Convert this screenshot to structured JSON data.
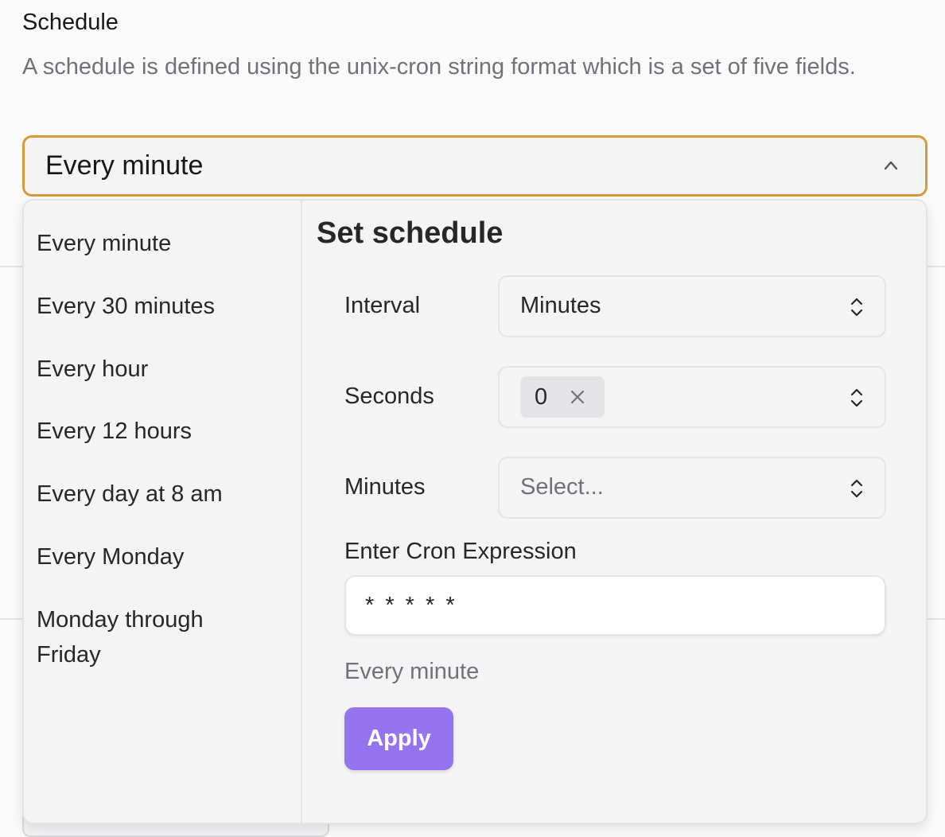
{
  "field": {
    "title": "Schedule",
    "description": "A schedule is defined using the unix-cron string format which is a set of five fields.",
    "selected": "Every minute",
    "accent_color": "#d89a3a"
  },
  "presets": [
    "Every minute",
    "Every 30 minutes",
    "Every hour",
    "Every 12 hours",
    "Every day at 8 am",
    "Every Monday",
    "Monday through Friday"
  ],
  "editor": {
    "title": "Set schedule",
    "interval": {
      "label": "Interval",
      "value": "Minutes"
    },
    "seconds": {
      "label": "Seconds",
      "chips": [
        "0"
      ]
    },
    "minutes": {
      "label": "Minutes",
      "placeholder": "Select..."
    },
    "cron": {
      "label": "Enter Cron Expression",
      "value": "* * * * *",
      "description": "Every minute"
    },
    "apply_label": "Apply",
    "apply_color": "#9673ef"
  }
}
